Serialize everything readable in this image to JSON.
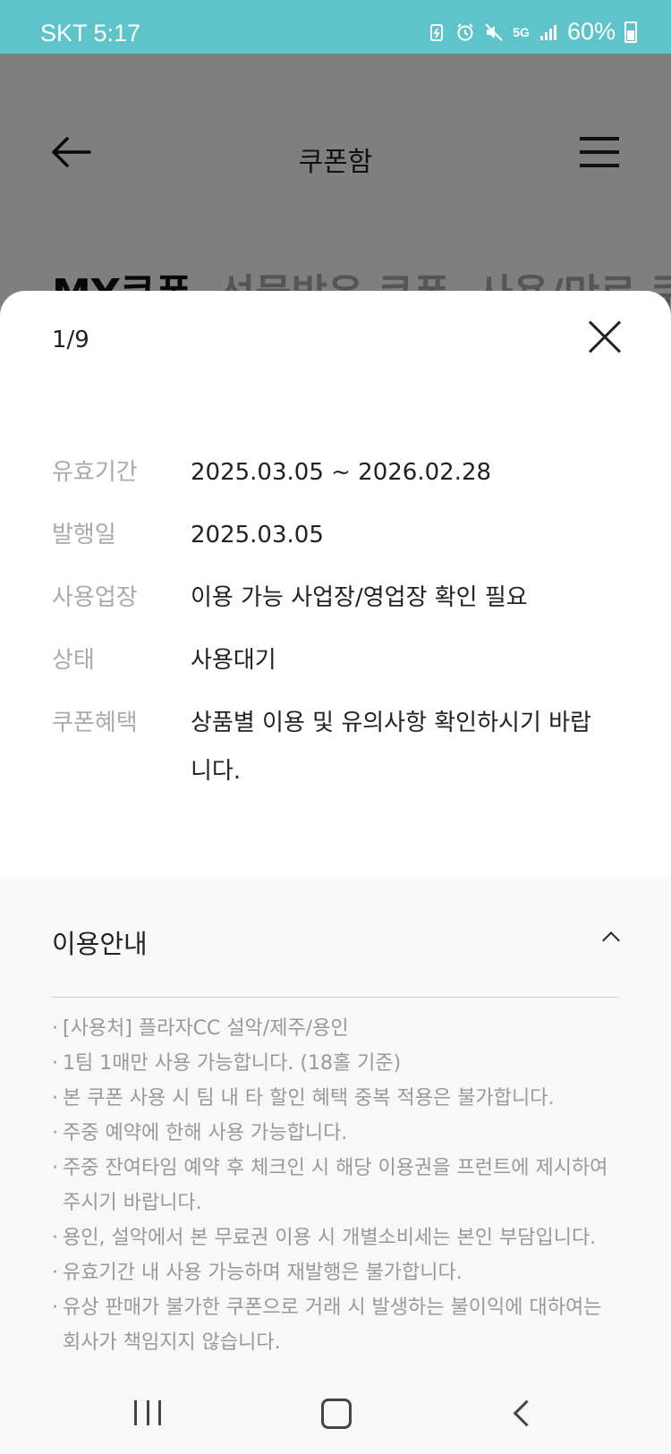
{
  "status_bar": {
    "carrier_time": "SKT 5:17",
    "network": "5G",
    "battery": "60%"
  },
  "app": {
    "title": "쿠폰함",
    "tabs": [
      {
        "label": "MY쿠폰",
        "active": true
      },
      {
        "label": "선물받은 쿠폰",
        "active": false
      },
      {
        "label": "사용/만료 쿠",
        "active": false
      }
    ]
  },
  "sheet": {
    "counter": "1/9",
    "details": [
      {
        "label": "유효기간",
        "value": "2025.03.05 ~ 2026.02.28"
      },
      {
        "label": "발행일",
        "value": "2025.03.05"
      },
      {
        "label": "사용업장",
        "value": "이용 가능 사업장/영업장 확인 필요"
      },
      {
        "label": "상태",
        "value": "사용대기"
      },
      {
        "label": "쿠폰혜택",
        "value": "상품별 이용 및 유의사항 확인하시기 바랍니다."
      }
    ],
    "guide": {
      "title": "이용안내",
      "items": [
        "[사용처] 플라자CC 설악/제주/용인",
        "1팀 1매만 사용 가능합니다. (18홀 기준)",
        "본 쿠폰 사용 시 팀 내 타 할인 혜택 중복 적용은 불가합니다.",
        "주중 예약에 한해 사용 가능합니다.",
        "주중 잔여타임 예약 후 체크인 시 해당 이용권을 프런트에 제시하여 주시기 바랍니다.",
        "용인, 설악에서 본 무료권 이용 시 개별소비세는 본인 부담입니다.",
        "유효기간 내 사용 가능하며 재발행은 불가합니다.",
        "유상 판매가 불가한 쿠폰으로 거래 시 발생하는 불이익에 대하여는 회사가 책임지지 않습니다."
      ]
    }
  }
}
